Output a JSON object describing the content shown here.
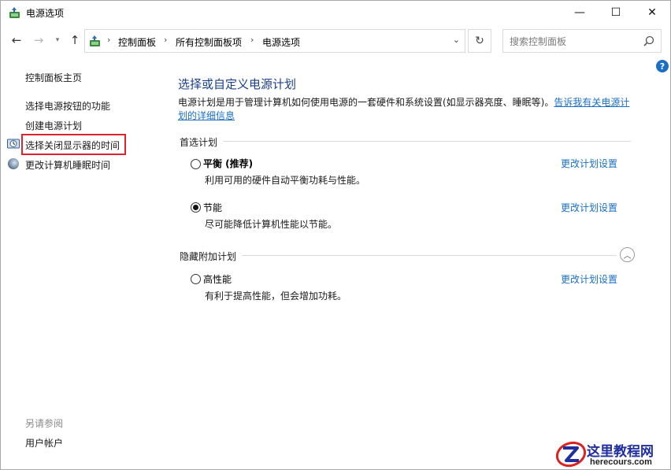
{
  "window": {
    "title": "电源选项",
    "minimize_glyph": "—",
    "maximize_glyph": "☐",
    "close_glyph": "✕"
  },
  "nav": {
    "back_glyph": "←",
    "forward_glyph": "→",
    "recent_glyph": "▾",
    "up_glyph": "↑",
    "refresh_glyph": "↻",
    "dropdown_glyph": "⌄"
  },
  "breadcrumb": {
    "items": [
      "控制面板",
      "所有控制面板项",
      "电源选项"
    ],
    "separator": "›"
  },
  "search": {
    "placeholder": "搜索控制面板"
  },
  "help_label": "?",
  "sidebar": {
    "home": "控制面板主页",
    "items": [
      "选择电源按钮的功能",
      "创建电源计划",
      "选择关闭显示器的时间",
      "更改计算机睡眠时间"
    ],
    "highlight_color": "#e0242e",
    "see_also_title": "另请参阅",
    "see_also_items": [
      "用户帐户"
    ]
  },
  "main": {
    "title": "选择或自定义电源计划",
    "description": "电源计划是用于管理计算机如何使用电源的一套硬件和系统设置(如显示器亮度、睡眠等)。",
    "description_link": "告诉我有关电源计划的详细信息",
    "preferred_section": "首选计划",
    "hidden_section": "隐藏附加计划",
    "collapse_glyph": "︿",
    "plans": [
      {
        "name": "平衡 (推荐)",
        "description": "利用可用的硬件自动平衡功耗与性能。",
        "link": "更改计划设置",
        "selected": false,
        "bold": true
      },
      {
        "name": "节能",
        "description": "尽可能降低计算机性能以节能。",
        "link": "更改计划设置",
        "selected": true,
        "bold": false
      }
    ],
    "hidden_plans": [
      {
        "name": "高性能",
        "description": "有利于提高性能，但会增加功耗。",
        "link": "更改计划设置",
        "selected": false
      }
    ]
  },
  "watermark": {
    "title": "这里教程网",
    "url": "herecours.com"
  },
  "colors": {
    "title_blue": "#1b3f8b",
    "link_blue": "#1a6fc4",
    "watermark_blue": "#1f2fa0"
  }
}
